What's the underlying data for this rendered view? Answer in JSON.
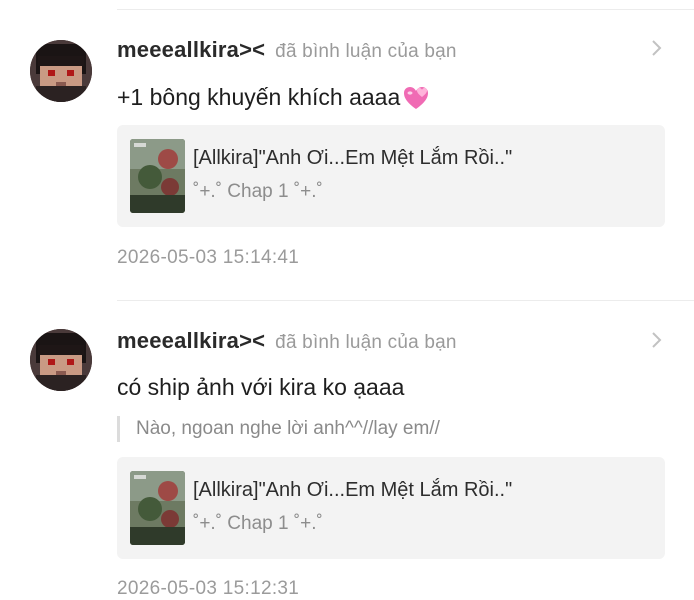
{
  "notifications": [
    {
      "username": "meeeallkira><",
      "action": "đã bình luận của bạn",
      "comment": "+1 bông khuyến khích aaaa",
      "comment_emoji": "two-hearts-icon",
      "quote": "",
      "card": {
        "title": "[Allkira]\"Anh Ơi...Em Mệt Lắm Rồi..\"",
        "subtitle": "˚+.˚ Chap 1 ˚+.˚"
      },
      "timestamp": "2026-05-03 15:14:41"
    },
    {
      "username": "meeeallkira><",
      "action": "đã bình luận của bạn",
      "comment": "có ship ảnh với kira ko ạaaa",
      "quote": "Nào, ngoan nghe lời anh^^//lay em//",
      "card": {
        "title": "[Allkira]\"Anh Ơi...Em Mệt Lắm Rồi..\"",
        "subtitle": "˚+.˚ Chap 1 ˚+.˚"
      },
      "timestamp": "2026-05-03 15:12:31"
    }
  ],
  "colors": {
    "card_bg": "#f3f3f3",
    "secondary_text": "#9a9a9a",
    "primary_text": "#222222",
    "heart_pink": "#f06bb4"
  }
}
